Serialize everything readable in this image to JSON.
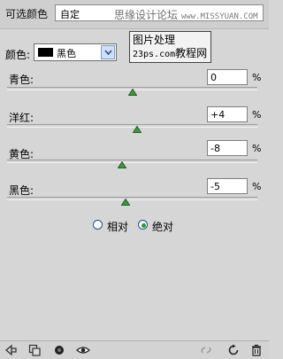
{
  "header": {
    "title": "可选颜色",
    "preset_value": "自定",
    "watermark_text": "思缘设计论坛",
    "watermark_url": "www.MISSYUAN.COM"
  },
  "tooltip": {
    "line1": "图片处理",
    "line2_a": "23ps.com",
    "line2_b": "教程网"
  },
  "colors": {
    "label": "颜色:",
    "selected": "黑色",
    "swatch": "#000000"
  },
  "sliders": [
    {
      "label": "青色:",
      "value": "0",
      "unit": "%"
    },
    {
      "label": "洋红:",
      "value": "+4",
      "unit": "%"
    },
    {
      "label": "黄色:",
      "value": "-8",
      "unit": "%"
    },
    {
      "label": "黑色:",
      "value": "-5",
      "unit": "%"
    }
  ],
  "method": {
    "relative_label": "相对",
    "absolute_label": "绝对",
    "selected": "absolute"
  },
  "theme": {
    "panel_bg": "#d6d6d6",
    "radio_selected": "#21a121",
    "thumb_color": "#2e8b2e"
  }
}
